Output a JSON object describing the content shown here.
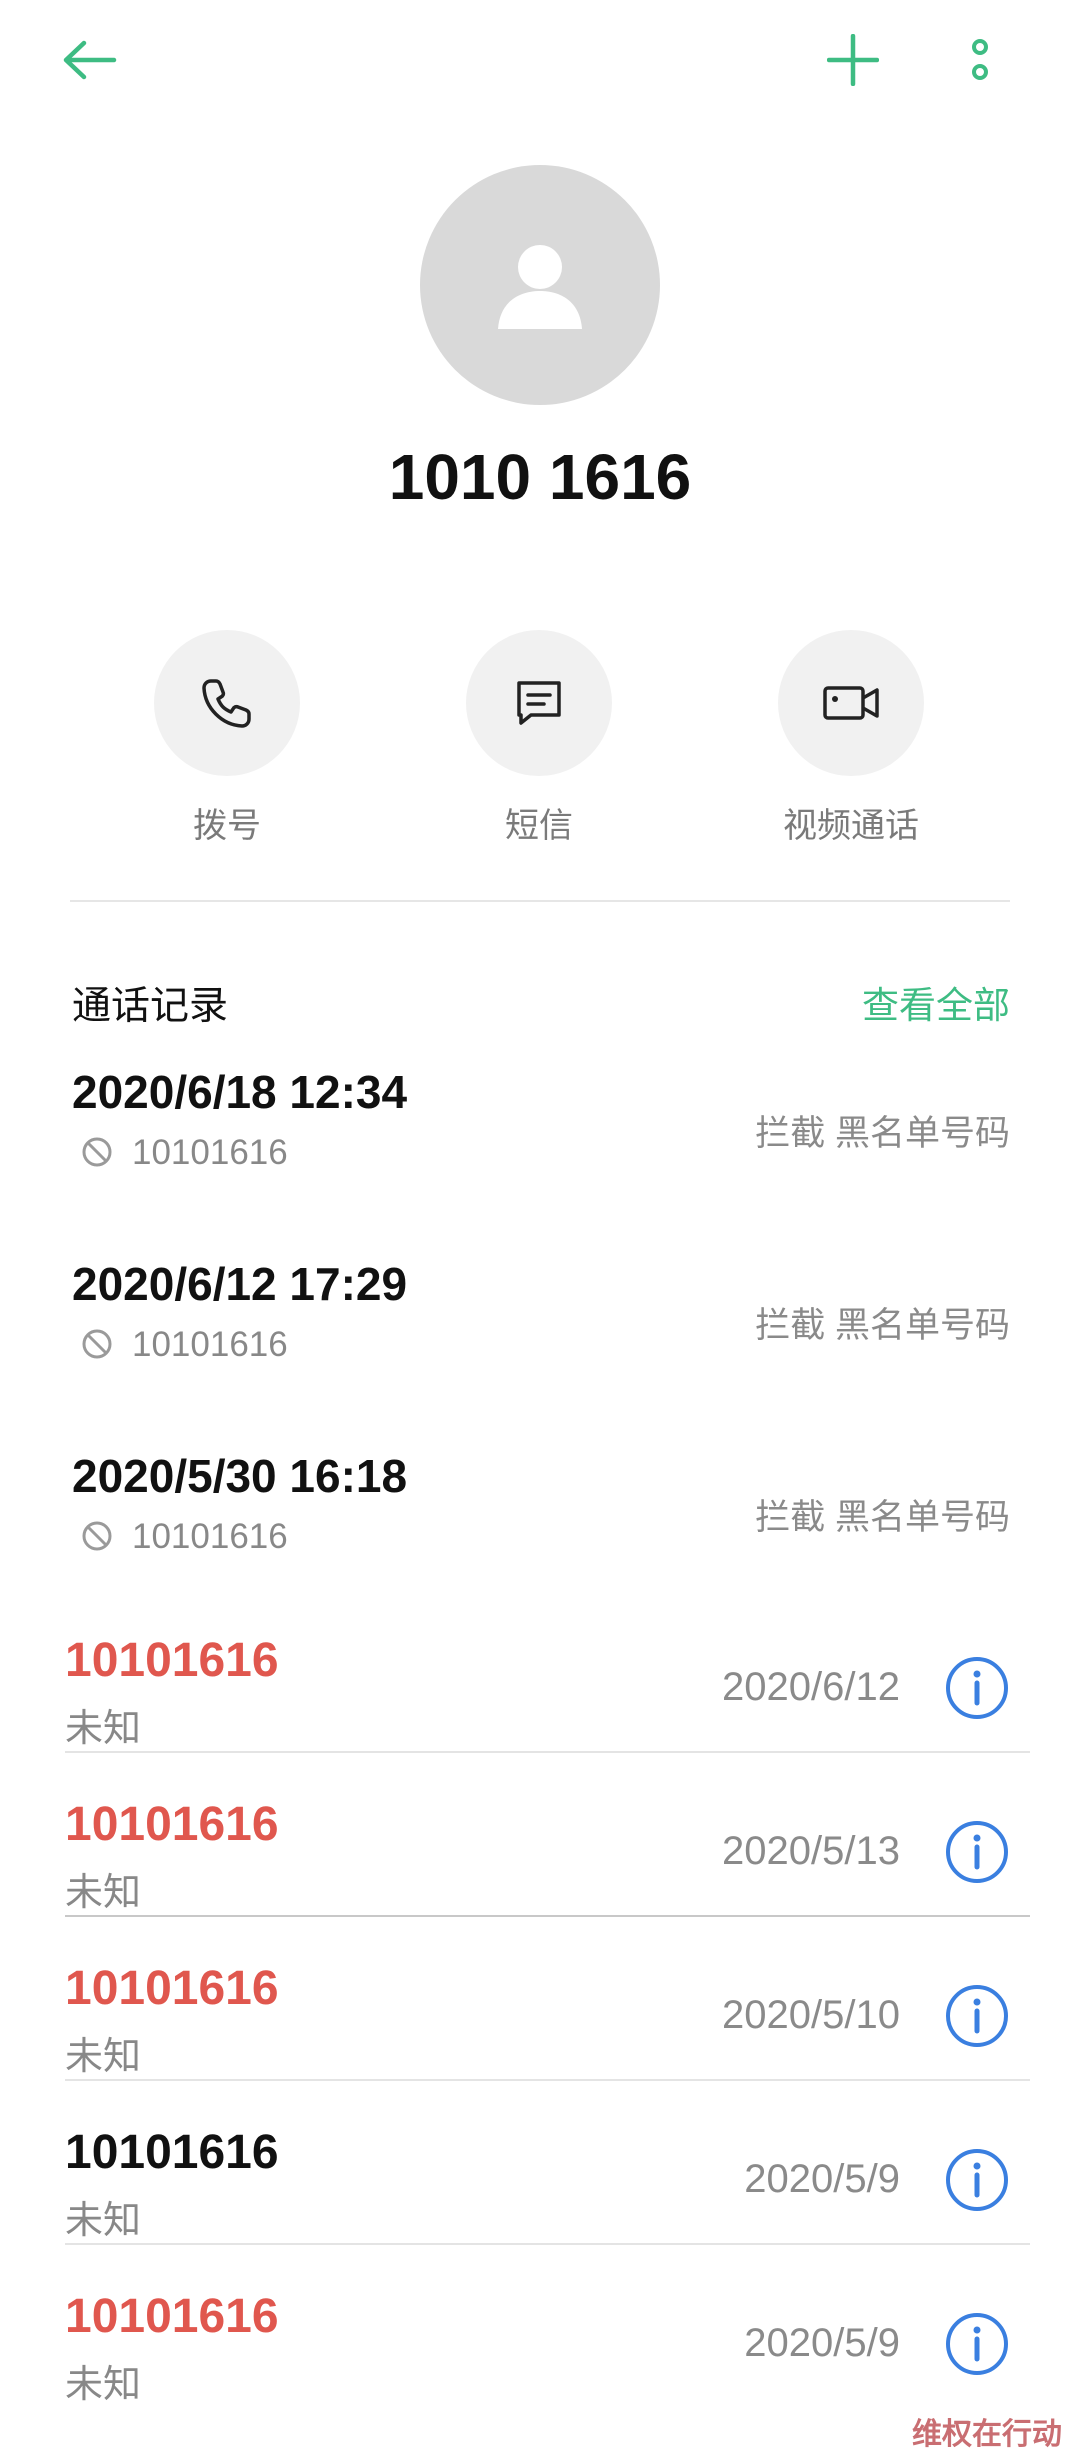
{
  "header": {
    "title": "1010 1616"
  },
  "colors": {
    "accent": "#3ebc83",
    "missed": "#e0574e",
    "info": "#3a7fe0"
  },
  "actions": [
    {
      "label": "拨号",
      "icon": "phone-icon"
    },
    {
      "label": "短信",
      "icon": "message-icon"
    },
    {
      "label": "视频通话",
      "icon": "video-call-icon"
    }
  ],
  "call_record": {
    "title": "通话记录",
    "view_all": "查看全部",
    "blocked": [
      {
        "time": "2020/6/18 12:34",
        "number": "10101616",
        "tag": "拦截  黑名单号码"
      },
      {
        "time": "2020/6/12 17:29",
        "number": "10101616",
        "tag": "拦截  黑名单号码"
      },
      {
        "time": "2020/5/30 16:18",
        "number": "10101616",
        "tag": "拦截  黑名单号码"
      }
    ]
  },
  "history": [
    {
      "number": "10101616",
      "sub": "未知",
      "date": "2020/6/12",
      "missed": true
    },
    {
      "number": "10101616",
      "sub": "未知",
      "date": "2020/5/13",
      "missed": true
    },
    {
      "number": "10101616",
      "sub": "未知",
      "date": "2020/5/10",
      "missed": true
    },
    {
      "number": "10101616",
      "sub": "未知",
      "date": "2020/5/9",
      "missed": false
    },
    {
      "number": "10101616",
      "sub": "未知",
      "date": "2020/5/9",
      "missed": true
    }
  ],
  "watermark": "维权在行动"
}
